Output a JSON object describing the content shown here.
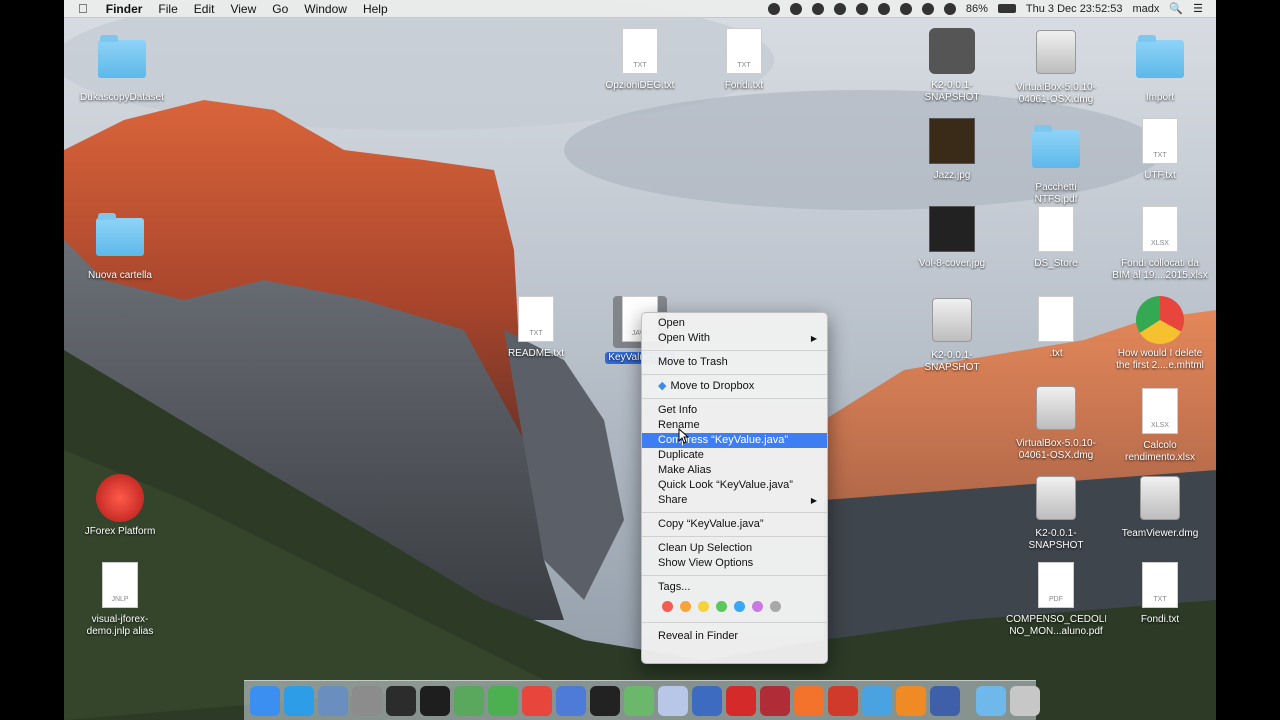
{
  "menubar": {
    "apple": "",
    "app_name": "Finder",
    "menus": [
      "File",
      "Edit",
      "View",
      "Go",
      "Window",
      "Help"
    ],
    "battery": "86%",
    "clock": "Thu 3 Dec  23:52:53",
    "user": "madx",
    "search_icon": "search-icon",
    "list_icon": "list-icon"
  },
  "desktop": {
    "icons": [
      {
        "label": "DukascopyDataset",
        "kind": "folder"
      },
      {
        "label": "OpzioniDEG.txt",
        "kind": "doc",
        "ext": "TXT"
      },
      {
        "label": "Fondi.txt",
        "kind": "doc",
        "ext": "TXT"
      },
      {
        "label": "K2-0.0.1-\nSNAPSHOT",
        "kind": "java"
      },
      {
        "label": "VirtualBox-5.0.10-\n04061-OSX.dmg",
        "kind": "disk"
      },
      {
        "label": "Import",
        "kind": "folder"
      },
      {
        "label": "Jazz.jpg",
        "kind": "thumb"
      },
      {
        "label": "Pacchetti\nNTFS.pdf",
        "kind": "folder"
      },
      {
        "label": "UTF.txt",
        "kind": "doc",
        "ext": "TXT"
      },
      {
        "label": "Nuova cartella",
        "kind": "folder"
      },
      {
        "label": "Vol-8-cover.jpg",
        "kind": "thumb"
      },
      {
        "label": "DS_Store",
        "kind": "doc",
        "ext": ""
      },
      {
        "label": "Fondi collocati da\nBIM al 19....2015.xlsx",
        "kind": "doc",
        "ext": "XLSX"
      },
      {
        "label": "README.txt",
        "kind": "doc",
        "ext": "TXT"
      },
      {
        "label": "KeyValue.java",
        "kind": "java-doc"
      },
      {
        "label": "K2-0.0.1-\nSNAPSHOT",
        "kind": "disk"
      },
      {
        "label": ".txt",
        "kind": "doc",
        "ext": ""
      },
      {
        "label": "How would I delete\nthe first 2....e.mhtml",
        "kind": "chrome"
      },
      {
        "label": "VirtualBox-5.0.10-\n04061-OSX.dmg",
        "kind": "disk"
      },
      {
        "label": "Calcolo\nrendimento.xlsx",
        "kind": "doc",
        "ext": "XLSX"
      },
      {
        "label": "JForex Platform",
        "kind": "jforex"
      },
      {
        "label": "K2-0.0.1-\nSNAPSHOT",
        "kind": "disk"
      },
      {
        "label": "TeamViewer.dmg",
        "kind": "disk"
      },
      {
        "label": "visual-jforex-\ndemo.jnlp alias",
        "kind": "jnlp"
      },
      {
        "label": "COMPENSO_CEDOLI\nNO_MON...aluno.pdf",
        "kind": "doc",
        "ext": "PDF"
      },
      {
        "label": "Fondi.txt",
        "kind": "doc",
        "ext": "TXT"
      }
    ]
  },
  "context_menu": {
    "items": [
      {
        "label": "Open"
      },
      {
        "label": "Open With",
        "submenu": true
      },
      {
        "sep": true
      },
      {
        "label": "Move to Trash"
      },
      {
        "sep": true
      },
      {
        "label": "Move to Dropbox",
        "icon": "dropbox-icon"
      },
      {
        "sep": true
      },
      {
        "label": "Get Info"
      },
      {
        "label": "Rename"
      },
      {
        "label": "Compress “KeyValue.java”",
        "highlighted": true
      },
      {
        "label": "Duplicate"
      },
      {
        "label": "Make Alias"
      },
      {
        "label": "Quick Look “KeyValue.java”"
      },
      {
        "label": "Share",
        "submenu": true
      },
      {
        "sep": true
      },
      {
        "label": "Copy “KeyValue.java”"
      },
      {
        "sep": true
      },
      {
        "label": "Clean Up Selection"
      },
      {
        "label": "Show View Options"
      },
      {
        "sep": true
      },
      {
        "label": "Tags..."
      },
      {
        "tags": true
      },
      {
        "sep": true
      },
      {
        "label": "Reveal in Finder"
      }
    ],
    "tag_colors": [
      "#f25c54",
      "#f7a33b",
      "#f5d33c",
      "#5ac85a",
      "#3ba6f5",
      "#c97ae0",
      "#a8a8a8"
    ]
  },
  "dock": {
    "apps": [
      {
        "name": "finder-icon",
        "color": "#3b8ff0"
      },
      {
        "name": "safari-icon",
        "color": "#2d9de8"
      },
      {
        "name": "preview-icon",
        "color": "#6a8fbf"
      },
      {
        "name": "system-preferences-icon",
        "color": "#8c8c8c"
      },
      {
        "name": "activity-monitor-icon",
        "color": "#2c2c2c"
      },
      {
        "name": "terminal-icon",
        "color": "#1e1e1e"
      },
      {
        "name": "android-studio-icon",
        "color": "#5aa85e"
      },
      {
        "name": "leaf-app-icon",
        "color": "#4caf50"
      },
      {
        "name": "chrome-icon",
        "color": "#e8453c"
      },
      {
        "name": "xcode-editor-icon",
        "color": "#4e7bd8"
      },
      {
        "name": "intellij-icon",
        "color": "#222222"
      },
      {
        "name": "network-icon",
        "color": "#6bb76b"
      },
      {
        "name": "virtualbox-icon",
        "color": "#b8c7e8"
      },
      {
        "name": "cube-app-icon",
        "color": "#3c6bbf"
      },
      {
        "name": "jforex-icon",
        "color": "#d42a2a"
      },
      {
        "name": "itunes-icon",
        "color": "#b02c36"
      },
      {
        "name": "brave-icon",
        "color": "#f3722c"
      },
      {
        "name": "db-icon",
        "color": "#cf3a2a"
      },
      {
        "name": "xcode-icon",
        "color": "#4aa3e0"
      },
      {
        "name": "vlc-icon",
        "color": "#f08a24"
      },
      {
        "name": "brackets-icon",
        "color": "#3f5fa8"
      },
      {
        "sep": true
      },
      {
        "name": "downloads-folder-icon",
        "color": "#6eb8ec"
      },
      {
        "name": "trash-icon",
        "color": "#c7c7c7"
      }
    ]
  }
}
